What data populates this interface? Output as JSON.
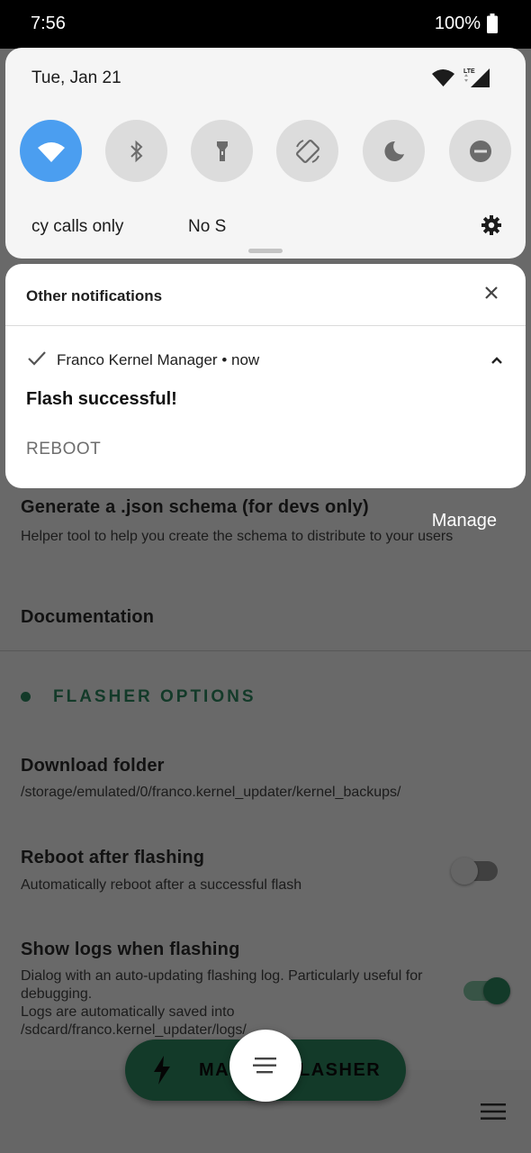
{
  "status_bar": {
    "time": "7:56",
    "battery": "100%"
  },
  "quick_settings": {
    "date": "Tue, Jan 21",
    "tiles": [
      "wifi-icon",
      "bluetooth-icon",
      "flashlight-icon",
      "auto-rotate-icon",
      "night-light-icon",
      "do-not-disturb-icon"
    ],
    "label_left": "cy calls only",
    "label_right": "No S"
  },
  "notification": {
    "header": "Other notifications",
    "app_line": "Franco Kernel Manager • now",
    "title": "Flash successful!",
    "action": "REBOOT"
  },
  "manage_label": "Manage",
  "app": {
    "items": [
      {
        "title": "Generate a .json schema (for devs only)",
        "subtitle": "Helper tool to help you create the schema to distribute to your users"
      },
      {
        "title": "Documentation"
      }
    ],
    "section_label": "FLASHER OPTIONS",
    "download": {
      "title": "Download folder",
      "subtitle": "/storage/emulated/0/franco.kernel_updater/kernel_backups/"
    },
    "reboot": {
      "title": "Reboot after flashing",
      "subtitle": "Automatically reboot after a successful flash",
      "enabled": false
    },
    "logs": {
      "title": "Show logs when flashing",
      "subtitle_1": "Dialog with an auto-updating flashing log. Particularly useful for debugging.",
      "subtitle_2": "Logs are automatically saved into /sdcard/franco.kernel_updater/logs/",
      "enabled": true
    },
    "fab_left": "MA",
    "fab_right": "LASHER"
  },
  "colors": {
    "accent": "#2e8b62",
    "wifi_tile": "#4b9ef0"
  }
}
